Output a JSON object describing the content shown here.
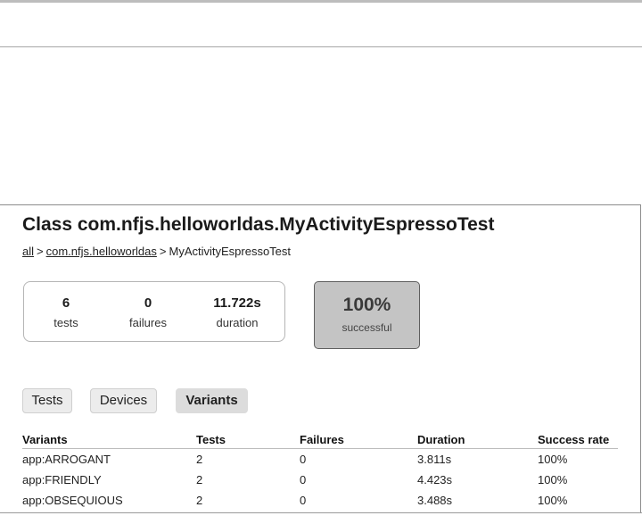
{
  "page": {
    "title": "Class com.nfjs.helloworldas.MyActivityEspressoTest",
    "breadcrumb": {
      "all": "all",
      "separator": ">",
      "package": "com.nfjs.helloworldas",
      "current": "MyActivityEspressoTest"
    }
  },
  "summary": {
    "tests_value": "6",
    "tests_label": "tests",
    "failures_value": "0",
    "failures_label": "failures",
    "duration_value": "11.722s",
    "duration_label": "duration"
  },
  "success": {
    "percent": "100%",
    "label": "successful"
  },
  "tabs": [
    {
      "label": "Tests",
      "active": false
    },
    {
      "label": "Devices",
      "active": false
    },
    {
      "label": "Variants",
      "active": true
    }
  ],
  "table": {
    "headers": [
      "Variants",
      "Tests",
      "Failures",
      "Duration",
      "Success rate"
    ],
    "rows": [
      [
        "app:ARROGANT",
        "2",
        "0",
        "3.811s",
        "100%"
      ],
      [
        "app:FRIENDLY",
        "2",
        "0",
        "4.423s",
        "100%"
      ],
      [
        "app:OBSEQUIOUS",
        "2",
        "0",
        "3.488s",
        "100%"
      ]
    ]
  },
  "colors": {
    "success_box_bg": "#c4c4c4",
    "active_tab_bg": "#dcdcdc"
  }
}
